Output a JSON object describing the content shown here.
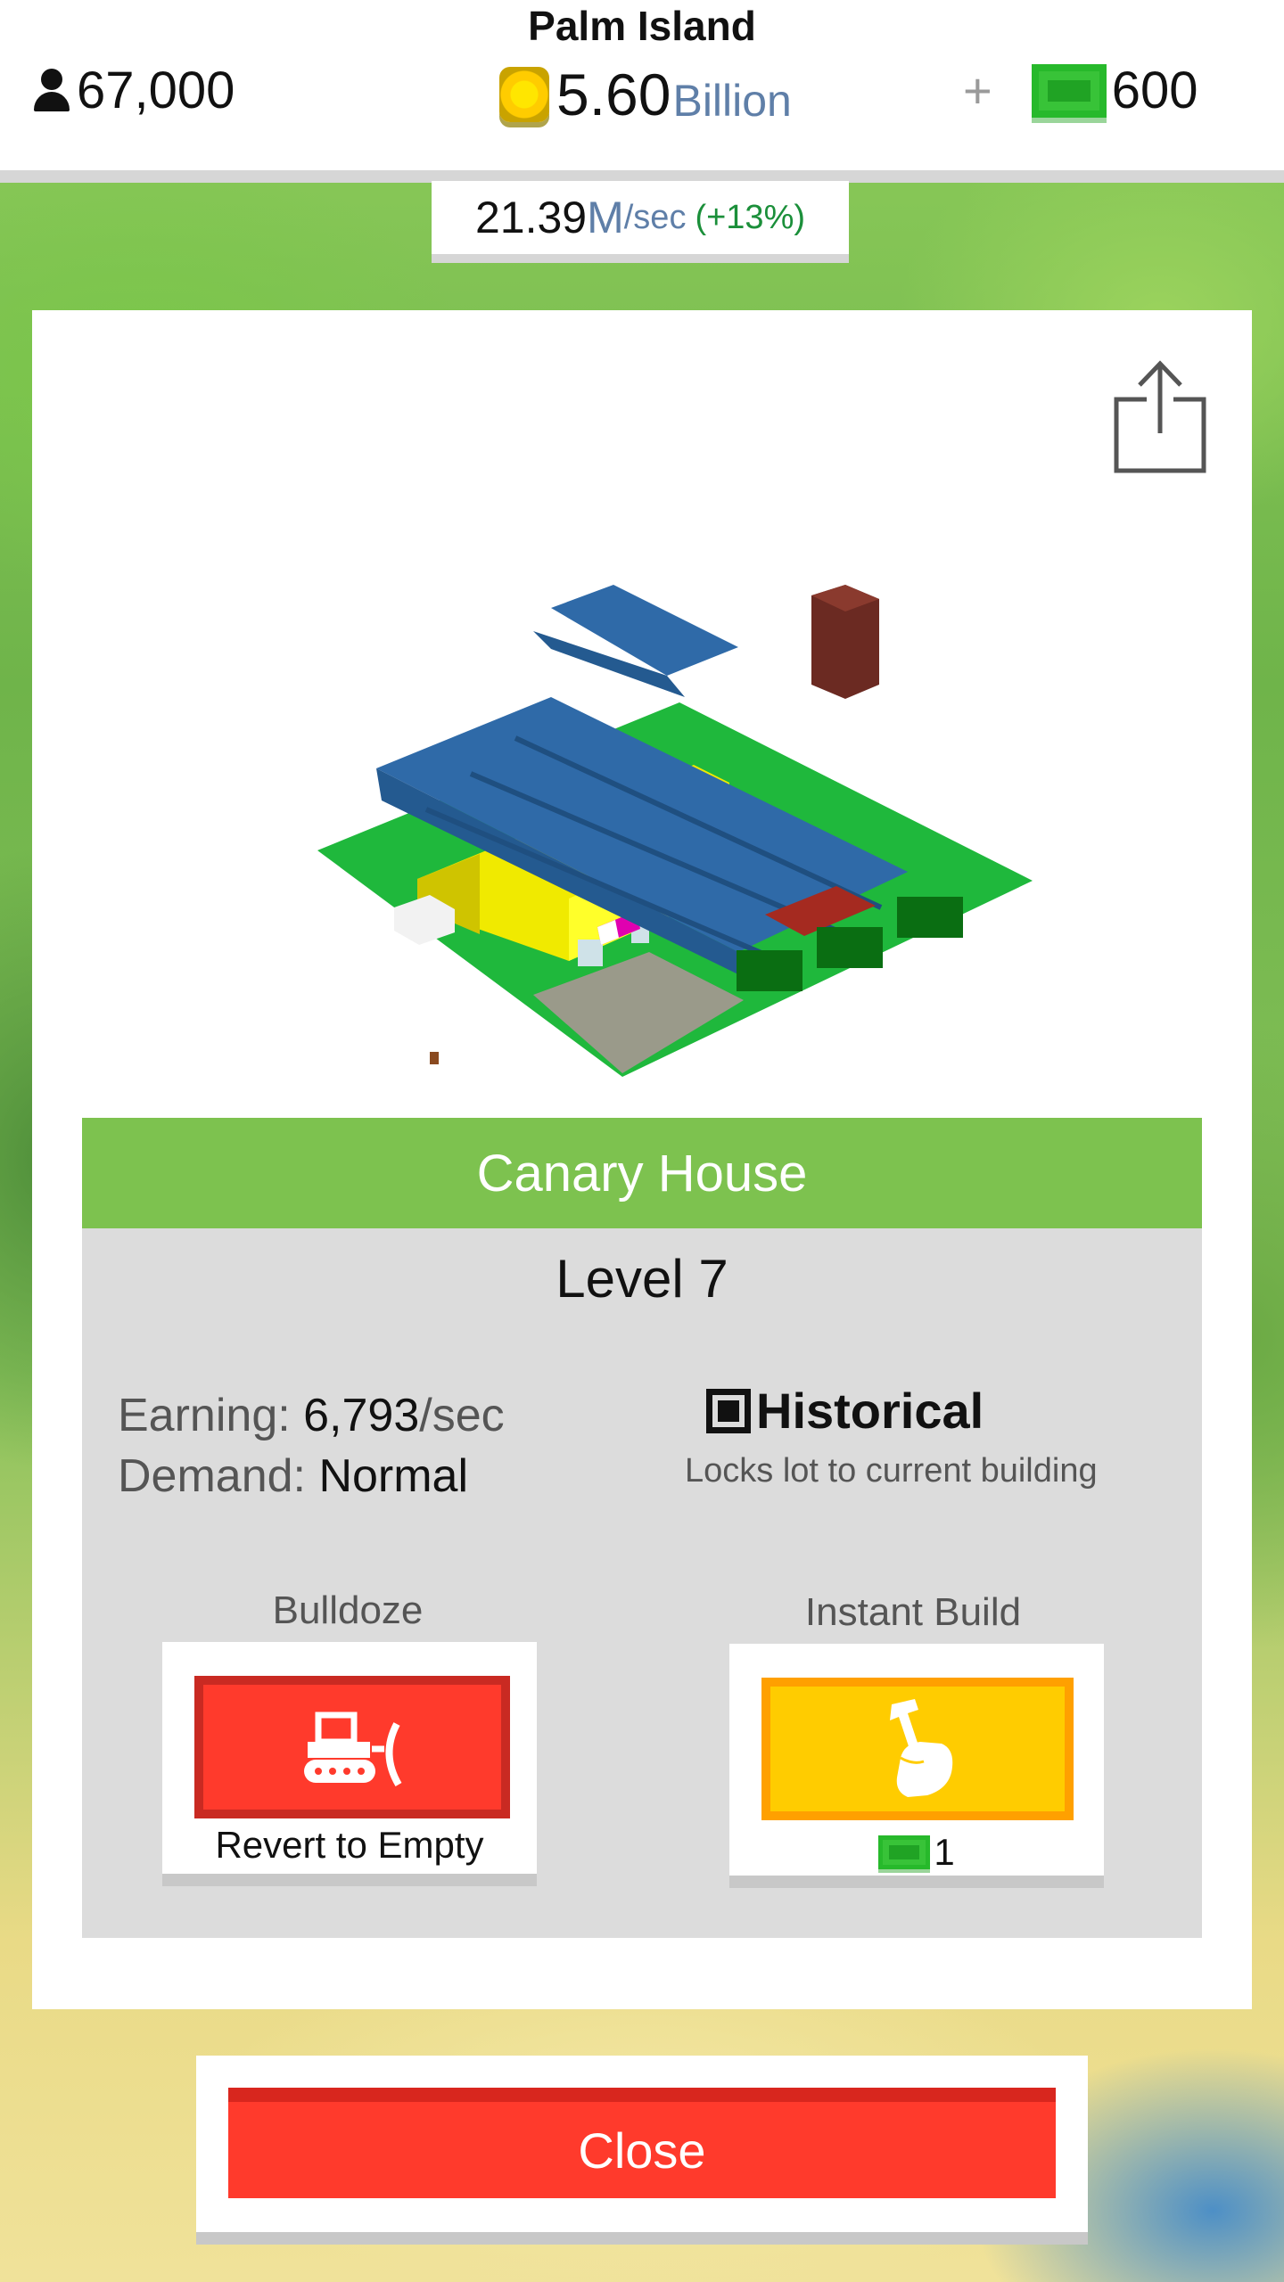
{
  "topbar": {
    "island_name": "Palm Island",
    "population": "67,000",
    "coins": "5.60",
    "coins_unit": "Billion",
    "plus": "+",
    "cash": "600"
  },
  "rate": {
    "value": "21.39",
    "unit": "M",
    "per": "/sec",
    "bonus": "(+13%)"
  },
  "building": {
    "name": "Canary House",
    "level": "Level 7",
    "earning_label": "Earning:",
    "earning_value": "6,793",
    "earning_unit": "/sec",
    "demand_label": "Demand:",
    "demand_value": "Normal",
    "historical_label": "Historical",
    "historical_desc": "Locks lot to current building",
    "historical_checked": true
  },
  "actions": {
    "bulldoze_label": "Bulldoze",
    "bulldoze_caption": "Revert to Empty",
    "instant_label": "Instant Build",
    "instant_cost": "1"
  },
  "close_label": "Close",
  "icons": [
    "person-icon",
    "coin-icon",
    "cash-bill-icon",
    "share-icon",
    "bulldozer-icon",
    "hammer-hand-icon"
  ],
  "colors": {
    "name_bar": "#7dc24f",
    "close_button": "#ff3a2c",
    "instant_button": "#ffcc00",
    "rate_bonus": "#1b8f3a"
  }
}
